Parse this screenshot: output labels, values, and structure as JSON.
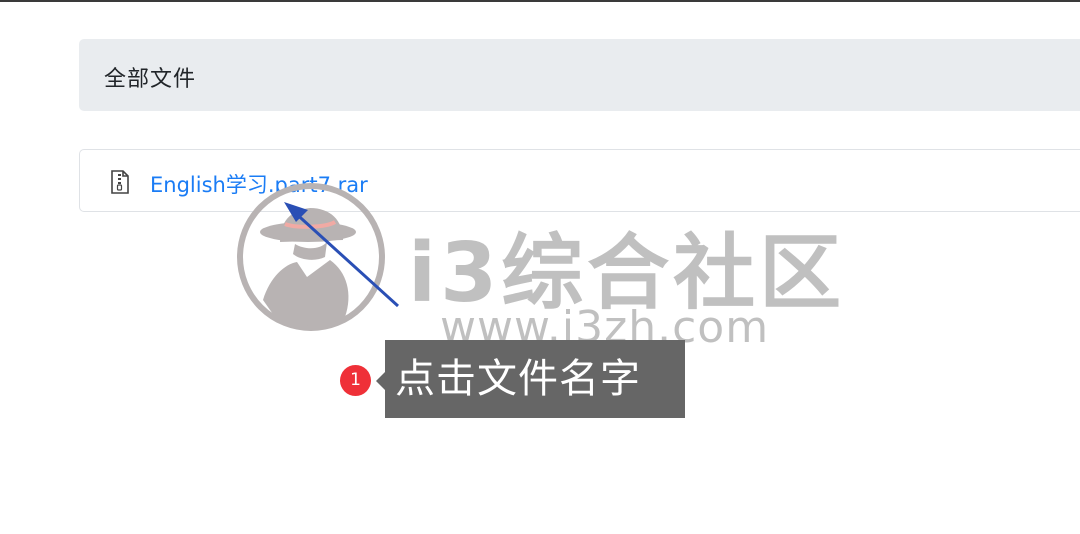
{
  "breadcrumb": {
    "label": "全部文件"
  },
  "files": [
    {
      "name": "English学习.part7.rar",
      "icon": "zip-file-icon"
    }
  ],
  "annotation": {
    "step_number": "1",
    "text": "点击文件名字",
    "badge_color": "#ef3038",
    "arrow_color": "#2a4fb5"
  },
  "watermark": {
    "title": "i3综合社区",
    "url": "www.i3zh.com",
    "logo": "detective-hat-logo"
  },
  "colors": {
    "link": "#1a7cf5",
    "breadcrumb_bg": "#e9ecef",
    "callout_bg": "#666666"
  }
}
